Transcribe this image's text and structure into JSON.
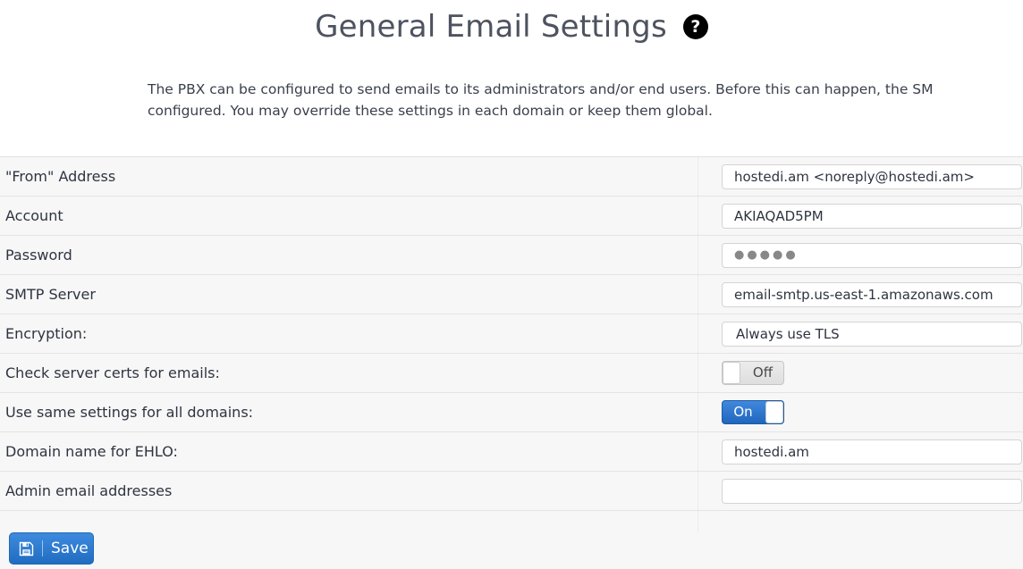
{
  "header": {
    "title": "General Email Settings",
    "help_icon": "help-circle-icon",
    "help_glyph": "?"
  },
  "intro": {
    "text": "The PBX can be configured to send emails to its administrators and/or end users. Before this can happen, the SM\nconfigured. You may override these settings in each domain or keep them global."
  },
  "settings": {
    "rows": [
      {
        "label": "\"From\" Address",
        "type": "text",
        "value": "hostedi.am <noreply@hostedi.am>",
        "placeholder": ""
      },
      {
        "label": "Account",
        "type": "text",
        "value": "AKIAQAD5PM",
        "placeholder": ""
      },
      {
        "label": "Password",
        "type": "password",
        "value": "●●●●●",
        "placeholder": ""
      },
      {
        "label": "SMTP Server",
        "type": "text",
        "value": "email-smtp.us-east-1.amazonaws.com",
        "placeholder": ""
      },
      {
        "label": "Encryption:",
        "type": "select",
        "value": "Always use TLS",
        "placeholder": ""
      },
      {
        "label": "Check server certs for emails:",
        "type": "toggle",
        "value": "Off",
        "placeholder": ""
      },
      {
        "label": "Use same settings for all domains:",
        "type": "toggle",
        "value": "On",
        "placeholder": ""
      },
      {
        "label": "Domain name for EHLO:",
        "type": "text",
        "value": "hostedi.am",
        "placeholder": ""
      },
      {
        "label": "Admin email addresses",
        "type": "text",
        "value": "",
        "placeholder": ""
      }
    ]
  },
  "footer": {
    "save_label": "Save",
    "save_icon": "floppy-disk-icon"
  },
  "colors": {
    "accent_blue": "#2f7ed3",
    "toggle_on": "#1f66bd",
    "toggle_off": "#e4e4e4",
    "panel_bg": "#f7f7f7",
    "title_text": "#4d5360"
  }
}
